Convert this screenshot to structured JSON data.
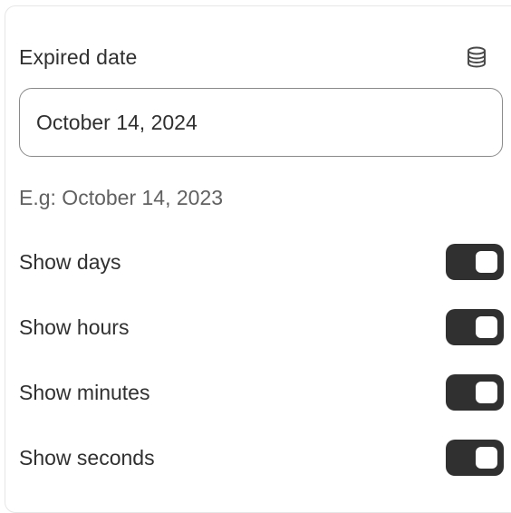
{
  "expired_date": {
    "label": "Expired date",
    "icon": "database-icon",
    "value": "October 14, 2024",
    "help_text": "E.g: October 14, 2023"
  },
  "toggles": [
    {
      "label": "Show days",
      "on": true
    },
    {
      "label": "Show hours",
      "on": true
    },
    {
      "label": "Show minutes",
      "on": true
    },
    {
      "label": "Show seconds",
      "on": true
    }
  ],
  "colors": {
    "toggle_on": "#303030",
    "text": "#303030",
    "help_text": "#616161",
    "input_border": "#8a8a8a"
  }
}
